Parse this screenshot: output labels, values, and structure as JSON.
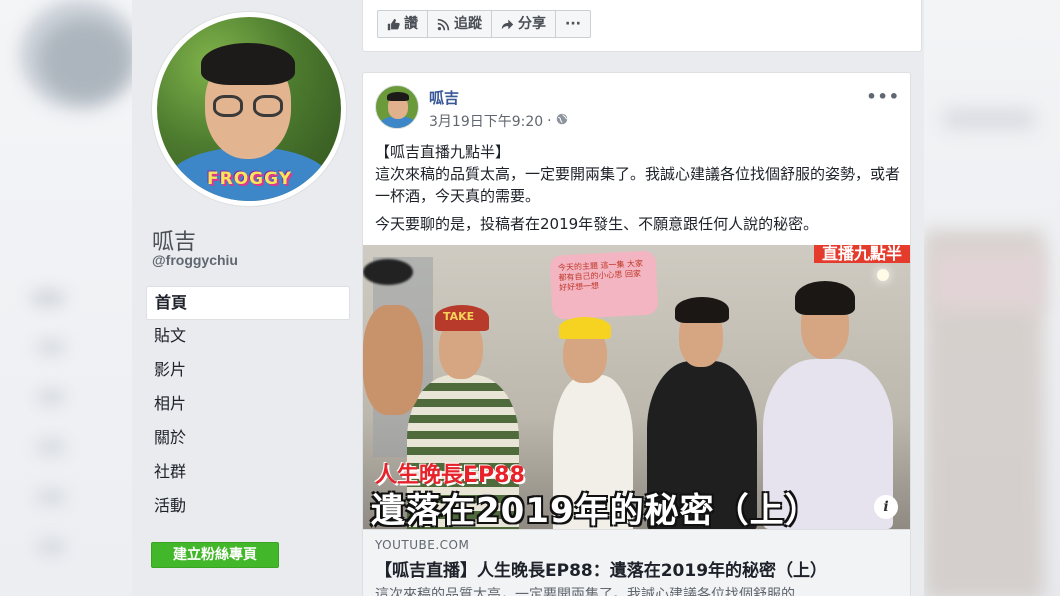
{
  "sidebar": {
    "page_name": "呱吉",
    "page_handle": "@froggychiu",
    "avatar_badge": "FROGGY",
    "nav_items": [
      "首頁",
      "貼文",
      "影片",
      "相片",
      "關於",
      "社群",
      "活動"
    ],
    "active_index": 0,
    "create_page_button": "建立粉絲專頁"
  },
  "action_bar": {
    "like_label": "讚",
    "follow_label": "追蹤",
    "share_label": "分享",
    "more_label": "···"
  },
  "post": {
    "author": "呱吉",
    "timestamp": "3月19日下午9:20",
    "privacy_icon": "globe-icon",
    "more_label": "•••",
    "text_line1": "【呱吉直播九點半】",
    "text_line2": "這次來稿的品質太高，一定要開兩集了。我誠心建議各位找個舒服的姿勢，或者一杯酒，今天真的需要。",
    "text_line3": "今天要聊的是，投稿者在2019年發生、不願意跟任何人說的秘密。",
    "video": {
      "corner_tag": "直播九點半",
      "sticky_note": "今天的主題 這一集 大家都有自己的小心思 回家好好想一想",
      "episode_title": "人生晚長EP88",
      "main_title": "遺落在2019年的秘密（上）",
      "take_cap": "TAKE"
    },
    "link": {
      "domain": "YOUTUBE.COM",
      "title": "【呱吉直播】人生晚長EP88：遺落在2019年的秘密（上）",
      "description": "這次來稿的品質太高，一定要開兩集了。我誠心建議各位找個舒服的"
    }
  },
  "colors": {
    "fb_link_blue": "#385898",
    "create_green": "#42b72a",
    "title_red": "#e8222a"
  }
}
